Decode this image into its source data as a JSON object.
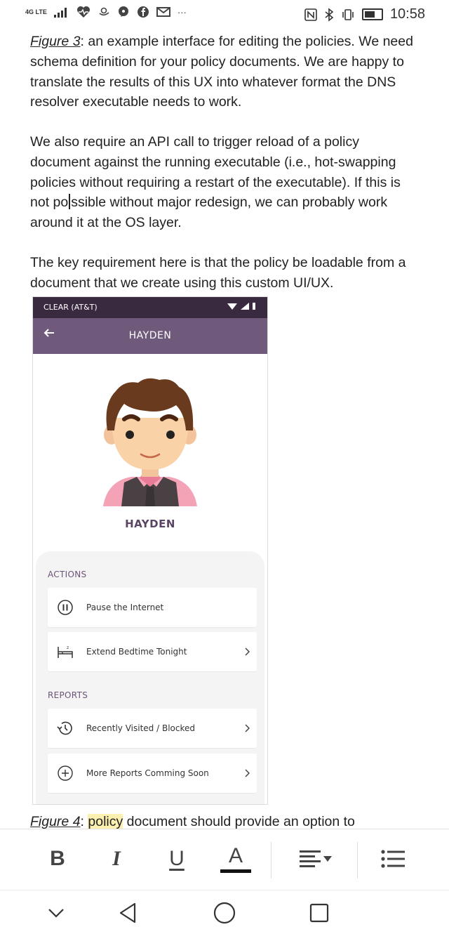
{
  "status_bar": {
    "network": "4G LTE",
    "time": "10:58",
    "more": "···"
  },
  "document": {
    "p1_ref": "Figure 3",
    "p1_text": ": an example interface for editing the policies. We need schema definition for your policy documents. We are happy to translate the results of this UX into whatever format the DNS resolver executable needs to work.",
    "p2_text_a": "We also require an API call to trigger reload of a policy document against the running executable (i.e., hot-swapping policies without requiring a restart of the executable). If this is not po",
    "p2_text_b": "ssible without major redesign, we can probably work around it at the OS layer.",
    "p3_text": "The key requirement here is that the policy be loadable from a document that we create using this custom UI/UX.",
    "p4_ref": "Figure 4",
    "p4_colon": ": ",
    "p4_highlight": "policy",
    "p4_text": " document should provide an option to"
  },
  "screenshot": {
    "carrier": "CLEAR (AT&T)",
    "header_title": "HAYDEN",
    "profile_name": "HAYDEN",
    "actions_label": "ACTIONS",
    "reports_label": "REPORTS",
    "rows": [
      {
        "label": "Pause the Internet",
        "icon": "pause-circle-icon"
      },
      {
        "label": "Extend Bedtime Tonight",
        "icon": "bed-icon"
      },
      {
        "label": "Recently Visited / Blocked",
        "icon": "history-icon"
      },
      {
        "label": "More Reports Comming Soon",
        "icon": "plus-circle-icon"
      }
    ]
  },
  "toolbar": {
    "bold": "B",
    "italic": "I",
    "underline": "U",
    "text_color": "A"
  },
  "colors": {
    "header_purple": "#6f5a7b",
    "status_dark": "#3a2a40",
    "accent_text": "#6d5378",
    "highlight": "#fbf0b0"
  }
}
